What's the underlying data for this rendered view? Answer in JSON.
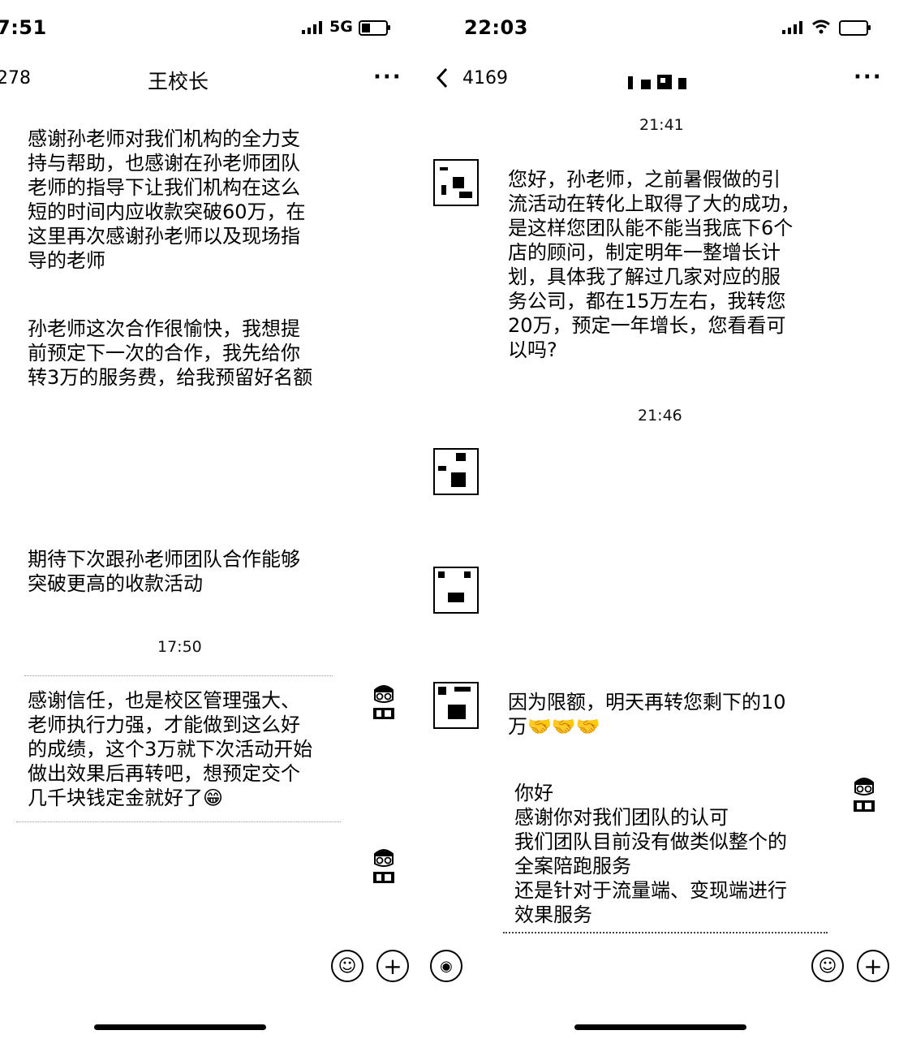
{
  "left": {
    "status": {
      "time": "7:51",
      "network": "5G"
    },
    "nav": {
      "back_count": "278",
      "title": "王校长",
      "more": "···"
    },
    "messages": [
      "感谢孙老师对我们机构的全力支\n持与帮助，也感谢在孙老师团队\n老师的指导下让我们机构在这么\n短的时间内应收款突破60万，在\n这里再次感谢孙老师以及现场指\n导的老师",
      "孙老师这次合作很愉快，我想提\n前预定下一次的合作，我先给你\n转3万的服务费，给我预留好名额",
      "期待下次跟孙老师团队合作能够\n突破更高的收款活动",
      "感谢信任，也是校区管理强大、\n老师执行力强，才能做到这么好\n的成绩，这个3万就下次活动开始\n做出效果后再转吧，想预定交个\n几千块钱定金就好了😁"
    ],
    "timestamp": "17:50",
    "toolbar": {
      "emoji": "☺",
      "plus": "+"
    }
  },
  "right": {
    "status": {
      "time": "22:03"
    },
    "nav": {
      "back_count": "4169",
      "more": "···"
    },
    "timestamps": [
      "21:41",
      "21:46"
    ],
    "messages": [
      "您好，孙老师，之前暑假做的引\n流活动在转化上取得了大的成功，\n是这样您团队能不能当我底下6个\n店的顾问，制定明年一整增长计\n划，具体我了解过几家对应的服\n务公司，都在15万左右，我转您\n20万，预定一年增长，您看看可\n以吗?",
      "因为限额，明天再转您剩下的10\n万🤝🤝🤝",
      "你好\n感谢你对我们团队的认可\n我们团队目前没有做类似整个的\n全案陪跑服务\n还是针对于流量端、变现端进行\n效果服务"
    ],
    "toolbar": {
      "voice": "◉",
      "emoji": "☺",
      "plus": "+"
    }
  },
  "colors": {
    "text": "#000000",
    "background": "#ffffff"
  }
}
